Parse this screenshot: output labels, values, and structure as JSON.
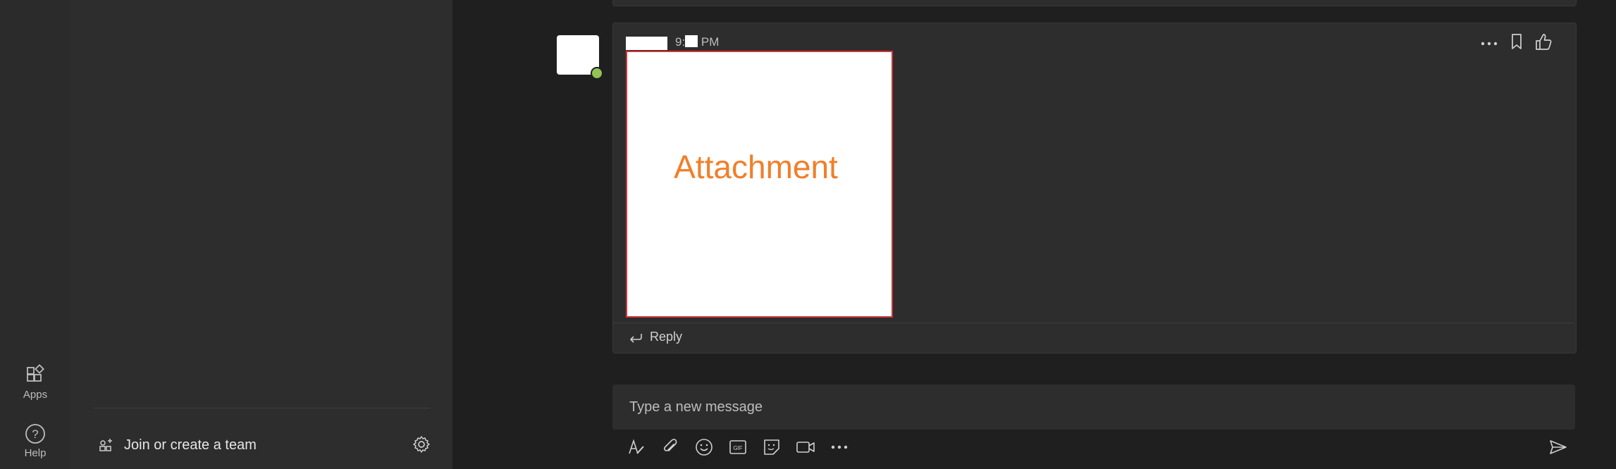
{
  "app_rail": {
    "items": [
      {
        "label": "Apps",
        "icon": "apps-icon"
      },
      {
        "label": "Help",
        "icon": "help-icon"
      }
    ]
  },
  "teams_pane": {
    "join_label": "Join or create a team"
  },
  "message": {
    "time": "PM",
    "time_prefix": "9:",
    "attachment_label": "Attachment",
    "reply_label": "Reply"
  },
  "compose": {
    "placeholder": "Type a new message"
  },
  "colors": {
    "accent_orange": "#f07f2a",
    "attachment_border": "#d13438",
    "presence": "#92c353"
  }
}
